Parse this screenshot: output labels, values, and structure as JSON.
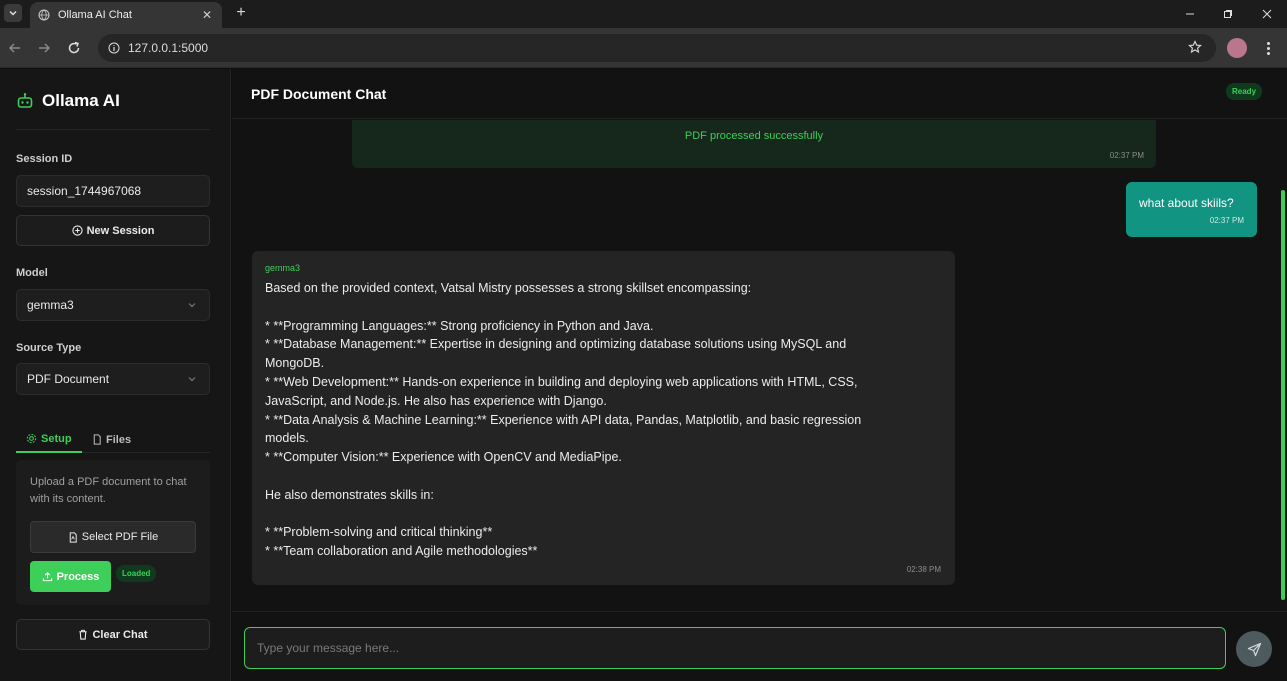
{
  "browser": {
    "tab_title": "Ollama AI Chat",
    "url": "127.0.0.1:5000"
  },
  "sidebar": {
    "brand": "Ollama AI",
    "session_label": "Session ID",
    "session_value": "session_1744967068",
    "new_session": "New Session",
    "model_label": "Model",
    "model_value": "gemma3",
    "source_label": "Source Type",
    "source_value": "PDF Document",
    "tabs": [
      {
        "label": "Setup",
        "active": true
      },
      {
        "label": "Files",
        "active": false
      }
    ],
    "setup_text": "Upload a PDF document to chat with its content.",
    "select_file": "Select PDF File",
    "process": "Process",
    "loaded_badge": "Loaded",
    "clear_chat": "Clear Chat"
  },
  "main": {
    "title": "PDF Document Chat",
    "status": "Ready",
    "input_placeholder": "Type your message here..."
  },
  "messages": [
    {
      "role": "system",
      "text": "PDF processed successfully",
      "time": "02:37 PM"
    },
    {
      "role": "user",
      "text": "what about skiils?",
      "time": "02:37 PM"
    },
    {
      "role": "assistant",
      "model": "gemma3",
      "time": "02:38 PM",
      "lines": [
        "Based on the provided context, Vatsal Mistry possesses a strong skillset encompassing:",
        "",
        "* **Programming Languages:** Strong proficiency in Python and Java.",
        "* **Database Management:** Expertise in designing and optimizing database solutions using MySQL and",
        "MongoDB.",
        "* **Web Development:** Hands-on experience in building and deploying web applications with HTML, CSS,",
        "JavaScript, and Node.js. He also has experience with Django.",
        "* **Data Analysis & Machine Learning:** Experience with API data, Pandas, Matplotlib, and basic regression",
        "models.",
        "* **Computer Vision:** Experience with OpenCV and MediaPipe.",
        "",
        "He also demonstrates skills in:",
        "",
        "* **Problem-solving and critical thinking**",
        "* **Team collaboration and Agile methodologies**"
      ]
    }
  ],
  "colors": {
    "accent": "#3ecf5a",
    "user_bubble": "#119482",
    "assistant_bubble": "#242424",
    "background": "#121212"
  },
  "icons": [
    "robot-icon",
    "plus-circle-icon",
    "chevron-down-icon",
    "gear-icon",
    "file-icon",
    "pdf-file-icon",
    "upload-icon",
    "trash-icon",
    "send-icon"
  ]
}
